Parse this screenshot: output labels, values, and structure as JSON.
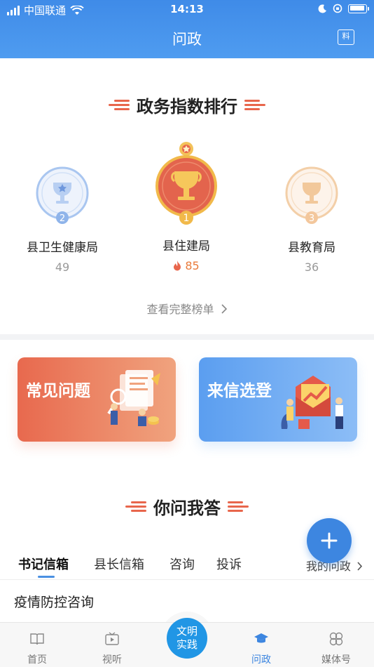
{
  "status": {
    "carrier": "中国联通",
    "time": "14:13"
  },
  "nav": {
    "title": "问政",
    "right_icon_label": "料"
  },
  "ranking": {
    "title": "政务指数排行",
    "items": [
      {
        "rank": "2",
        "name": "县卫生健康局",
        "score": "49"
      },
      {
        "rank": "1",
        "name": "县住建局",
        "score": "85"
      },
      {
        "rank": "3",
        "name": "县教育局",
        "score": "36"
      }
    ],
    "view_all": "查看完整榜单"
  },
  "cards": {
    "faq": "常见问题",
    "letters": "来信选登"
  },
  "qa": {
    "title": "你问我答",
    "tabs": [
      "书记信箱",
      "县长信箱",
      "咨询",
      "投诉"
    ],
    "my_questions": "我的问政",
    "items": [
      "疫情防控咨询"
    ]
  },
  "tabbar": {
    "items": [
      "首页",
      "视听",
      "问政",
      "媒体号"
    ],
    "center_line1": "文明",
    "center_line2": "实践"
  },
  "colors": {
    "primary": "#3d86e0",
    "accent": "#e8664c",
    "gold": "#e9a33c"
  }
}
